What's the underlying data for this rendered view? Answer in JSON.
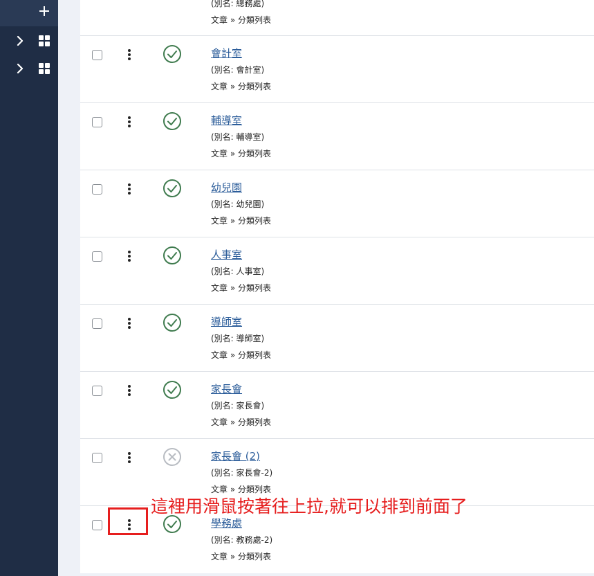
{
  "sidebar": {
    "items": [
      {
        "icon": "plus-icon"
      },
      {
        "icon": "chevron-right-icon",
        "icon2": "grid-icon"
      },
      {
        "icon": "chevron-right-icon",
        "icon2": "grid-icon"
      }
    ]
  },
  "list": {
    "first_partial": {
      "alias": "(別名: 總務處)",
      "crumb": "文章 » 分類列表"
    },
    "rows": [
      {
        "title": "會計室",
        "alias": "(別名: 會計室)",
        "crumb": "文章 » 分類列表",
        "status": "published"
      },
      {
        "title": "輔導室",
        "alias": "(別名: 輔導室)",
        "crumb": "文章 » 分類列表",
        "status": "published"
      },
      {
        "title": "幼兒園",
        "alias": "(別名: 幼兒園)",
        "crumb": "文章 » 分類列表",
        "status": "published"
      },
      {
        "title": "人事室",
        "alias": "(別名: 人事室)",
        "crumb": "文章 » 分類列表",
        "status": "published"
      },
      {
        "title": "導師室",
        "alias": "(別名: 導師室)",
        "crumb": "文章 » 分類列表",
        "status": "published"
      },
      {
        "title": "家長會",
        "alias": "(別名: 家長會)",
        "crumb": "文章 » 分類列表",
        "status": "published"
      },
      {
        "title": "家長會 (2)",
        "alias": "(別名: 家長會-2)",
        "crumb": "文章 » 分類列表",
        "status": "unpublished"
      },
      {
        "title": "學務處",
        "alias": "(別名: 教務處-2)",
        "crumb": "文章 » 分類列表",
        "status": "published"
      }
    ]
  },
  "annotation": {
    "text": "這裡用滑鼠按著往上拉,就可以排到前面了",
    "color": "#e61e1e"
  },
  "colors": {
    "sidebar_bg": "#1f2d45",
    "link": "#2c5d9a",
    "published": "#3f7b4e",
    "unpublished": "#b8bcc2"
  }
}
